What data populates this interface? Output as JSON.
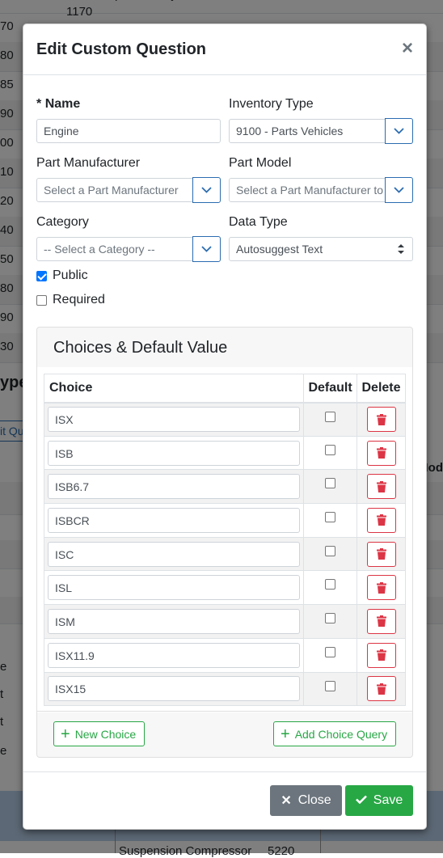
{
  "background": {
    "rows": [
      {
        "num": "70",
        "col2": "1170"
      },
      {
        "num": "80",
        "col2": ""
      },
      {
        "num": "85",
        "col2": ""
      },
      {
        "num": "90",
        "col2": ""
      },
      {
        "num": "00",
        "col2": ""
      },
      {
        "num": "10",
        "col2": ""
      },
      {
        "num": "20",
        "col2": ""
      },
      {
        "num": "40",
        "col2": ""
      },
      {
        "num": "50",
        "col2": ""
      },
      {
        "num": "80",
        "col2": ""
      },
      {
        "num": "90",
        "col2": ""
      },
      {
        "num": "30",
        "col2": ""
      }
    ],
    "header_text": "ype",
    "link_text": "it Qu",
    "col_text": "Mod",
    "side_letters": [
      "e",
      "t",
      "t",
      "e"
    ],
    "bottom_text": "Suspension Compressor",
    "bottom_num": "5220"
  },
  "modal": {
    "title": "Edit Custom Question",
    "close_symbol": "×",
    "name": {
      "required_mark": "*",
      "label": "Name",
      "value": "Engine"
    },
    "inventory_type": {
      "label": "Inventory Type",
      "value": "9100 - Parts Vehicles"
    },
    "part_manufacturer": {
      "label": "Part Manufacturer",
      "placeholder": "Select a Part Manufacturer"
    },
    "part_model": {
      "label": "Part Model",
      "placeholder": "Select a Part Manufacturer to"
    },
    "category": {
      "label": "Category",
      "placeholder": "-- Select a Category --"
    },
    "data_type": {
      "label": "Data Type",
      "value": "Autosuggest Text"
    },
    "public": {
      "label": "Public",
      "checked": true
    },
    "required": {
      "label": "Required",
      "checked": false
    },
    "choices_card": {
      "title": "Choices & Default Value",
      "headers": {
        "choice": "Choice",
        "default": "Default",
        "delete": "Delete"
      },
      "rows": [
        {
          "value": "ISX",
          "default": false
        },
        {
          "value": "ISB",
          "default": false
        },
        {
          "value": "ISB6.7",
          "default": false
        },
        {
          "value": "ISBCR",
          "default": false
        },
        {
          "value": "ISC",
          "default": false
        },
        {
          "value": "ISL",
          "default": false
        },
        {
          "value": "ISM",
          "default": false
        },
        {
          "value": "ISX11.9",
          "default": false
        },
        {
          "value": "ISX15",
          "default": false
        }
      ],
      "new_choice_label": "New Choice",
      "add_query_label": "Add Choice Query"
    },
    "footer": {
      "close_label": "Close",
      "save_label": "Save"
    }
  },
  "colors": {
    "primary": "#2b6cb0",
    "success": "#28a745",
    "danger": "#dc3545",
    "secondary": "#6c757d"
  }
}
